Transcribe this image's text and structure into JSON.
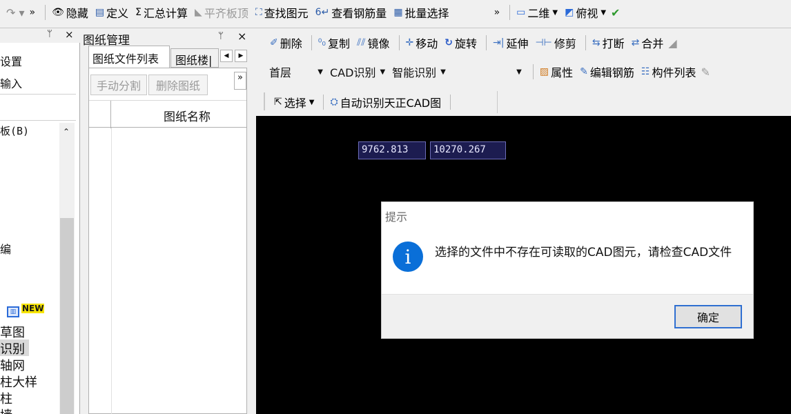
{
  "top_toolbar": {
    "items": [
      {
        "label": "隐藏",
        "icon": "eye-icon"
      },
      {
        "label": "定义",
        "icon": "define-icon"
      },
      {
        "label": "汇总计算",
        "icon": "sigma-icon"
      },
      {
        "label": "平齐板顶",
        "icon": "align-icon",
        "disabled": true
      },
      {
        "label": "查找图元",
        "icon": "binoculars-icon"
      },
      {
        "label": "查看钢筋量",
        "icon": "rebar-icon"
      },
      {
        "label": "批量选择",
        "icon": "batch-select-icon"
      }
    ],
    "more": "»",
    "view_mode": "二维",
    "view_direction": "俯视"
  },
  "left_panel": {
    "items": [
      "设置",
      "输入",
      "板(B)",
      "编",
      "草图",
      "识别",
      "轴网",
      "柱大样",
      "柱",
      "墙"
    ],
    "new_badge": "NEW"
  },
  "drawing_panel": {
    "title": "图纸管理",
    "tabs": [
      "图纸文件列表",
      "图纸楼|"
    ],
    "buttons": [
      "手动分割",
      "删除图纸"
    ],
    "more": "»",
    "column_header": "图纸名称"
  },
  "edit_toolbar": {
    "items": [
      "删除",
      "复制",
      "镜像",
      "移动",
      "旋转",
      "延伸",
      "修剪",
      "打断",
      "合并"
    ]
  },
  "property_toolbar": {
    "floor": "首层",
    "mode": "CAD识别",
    "smart": "智能识别",
    "items": [
      "属性",
      "编辑钢筋",
      "构件列表"
    ]
  },
  "select_toolbar": {
    "select": "选择",
    "auto_recognize": "自动识别天正CAD图"
  },
  "canvas": {
    "coord_x": "9762.813",
    "coord_y": "10270.267"
  },
  "dialog": {
    "title": "提示",
    "message": "选择的文件中不存在可读取的CAD图元，请检查CAD文件",
    "ok": "确定"
  }
}
